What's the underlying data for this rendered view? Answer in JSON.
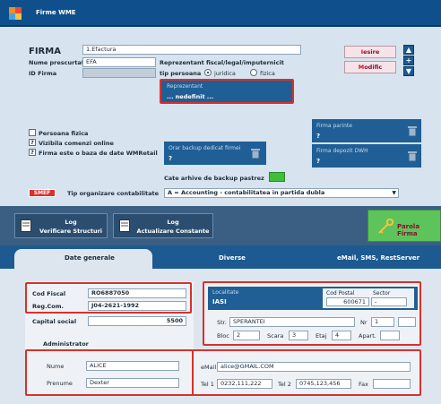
{
  "window": {
    "title": "Firme WME"
  },
  "header": {
    "firma_label": "FIRMA",
    "firma_value": "1.Efactura",
    "nume_prescurtat_label": "Nume prescurtat",
    "nume_prescurtat_value": "EFA",
    "id_firma_label": "ID Firma",
    "id_firma_value": ""
  },
  "representative": {
    "title": "Reprezentant fiscal/legal/imputernicit",
    "tip_persoana_label": "tip persoana",
    "option_juridica": "juridica",
    "option_fizica": "fizica",
    "selected": "juridica",
    "box_label": "Reprezentant",
    "box_value": "... nedefinit ..."
  },
  "actions": {
    "iesire_hotkey": "I",
    "iesire_rest": "esire",
    "modific_hotkey": "M",
    "modific_rest": "odific",
    "up_symbol": "▲",
    "add_symbol": "+",
    "down_symbol": "▼"
  },
  "options": {
    "persoana_fizica": "Persoana fizica",
    "vizibila_comenzi": "Vizibila comenzi online",
    "firma_baza_date": "Firma este o baza de date WMRetail",
    "q_mark": "?"
  },
  "backup": {
    "orar_label": "Orar backup dedicat  firmei",
    "orar_value": "?",
    "cate_arhive_label": "Cate arhive de backup pastrez"
  },
  "firma_parinte": {
    "label": "Firma parinte",
    "value": "?"
  },
  "firma_depozit": {
    "label": "Firma depozit DWH",
    "value": "?"
  },
  "organizare": {
    "badge": "SMEF",
    "label": "Tip organizare contabilitate",
    "value": "A = Accounting - contabilitatea in partida dubla"
  },
  "toolbar": {
    "log_verificare_line1": "Log",
    "log_verificare_line2": "Verificare Structuri",
    "log_actualizare_line1": "Log",
    "log_actualizare_line2": "Actualizare Constante",
    "parola_firma": "Parola Firma"
  },
  "tabs": [
    "Date generale",
    "Diverse",
    "eMail, SMS, RestServer"
  ],
  "general": {
    "cod_fiscal_label": "Cod Fiscal",
    "cod_fiscal_value": "RO6887050",
    "reg_com_label": "Reg.Com.",
    "reg_com_value": "J04-2621-1992",
    "capital_social_label": "Capital social",
    "capital_social_value": "5500",
    "administrator_label": "Administrator",
    "nume_label": "Nume",
    "nume_value": "ALICE",
    "prenume_label": "Prenume",
    "prenume_value": "Dexter"
  },
  "address": {
    "localitate_label": "Localitate",
    "localitate_value": "IASI",
    "cod_postal_label": "Cod Postal",
    "cod_postal_value": "600671",
    "sector_label": "Sector",
    "sector_value": "-",
    "str_label": "Str.",
    "str_value": "SPERANTEI",
    "nr_label": "Nr",
    "nr_value": "1",
    "bloc_label": "Bloc",
    "bloc_value": "2",
    "scara_label": "Scara",
    "scara_value": "3",
    "etaj_label": "Etaj",
    "etaj_value": "4",
    "apart_label": "Apart.",
    "apart_value": ""
  },
  "contact": {
    "email_label": "eMail",
    "email_value": "alice@GMAIL.COM",
    "tel1_label": "Tel 1",
    "tel1_value": "0232,111,222",
    "tel2_label": "Tel 2",
    "tel2_value": "0745,123,456",
    "fax_label": "Fax",
    "fax_value": ""
  },
  "colors": {
    "title_bar": "#0f4f8c",
    "highlight_red": "#d9312b",
    "parola_green": "#5cc45a",
    "backup_green": "#3fbf3a"
  }
}
